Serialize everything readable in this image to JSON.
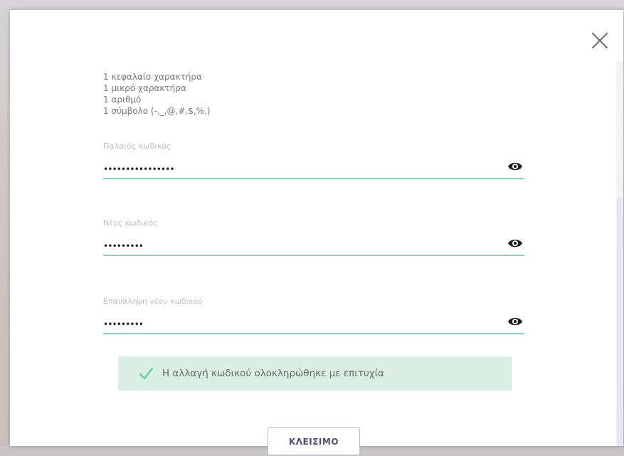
{
  "requirements": [
    "1 κεφαλαίο χαρακτήρα",
    "1 μικρό χαρακτήρα",
    "1 αριθμό",
    "1 σύμβολο (-,_,@,#,$,%,)"
  ],
  "fields": {
    "old_password": {
      "label": "Παλαιός κωδικός",
      "value": "••••••••••••••••"
    },
    "new_password": {
      "label": "Νέος κωδικός",
      "value": "•••••••••"
    },
    "confirm_password": {
      "label": "Επανάληψη νέου κωδικού",
      "value": "•••••••••"
    }
  },
  "success_message": "Η αλλαγή κωδικού ολοκληρώθηκε με επιτυχία",
  "close_button_label": "ΚΛΕΙΣΙΜΟ",
  "icons": {
    "close": "close-icon",
    "eye": "eye-icon",
    "check": "check-icon"
  },
  "colors": {
    "accent": "#86d3bc",
    "success_bg": "#d9efe6",
    "check": "#5cc6a0",
    "button_border": "#b8bcd8"
  }
}
